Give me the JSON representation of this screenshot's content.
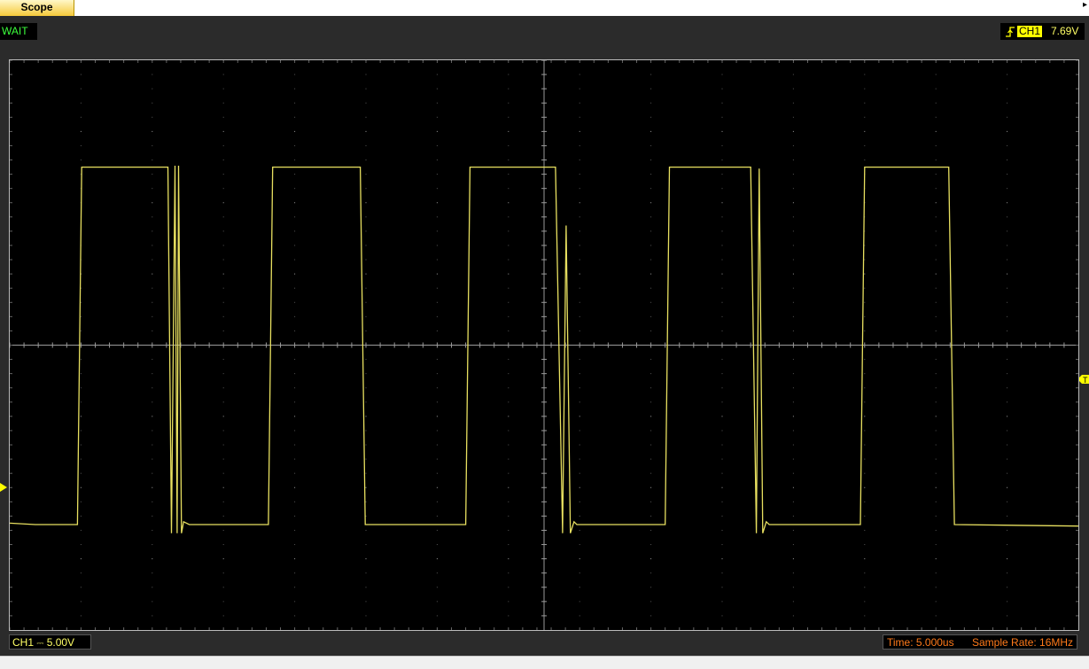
{
  "tab": {
    "label": "Scope"
  },
  "status": {
    "acquisition": "WAIT"
  },
  "trigger": {
    "channel": "CH1",
    "level": "7.69V",
    "edge": "rising-edge-icon"
  },
  "channel": {
    "name": "CH1",
    "coupling": "DC",
    "scale": "5.00V"
  },
  "timebase": {
    "time_label": "Time:",
    "time": "5.000us",
    "sample_label": "Sample Rate:",
    "sample_rate": "16MHz"
  },
  "colors": {
    "trace": "#e8e060",
    "grid": "#9a9a9a",
    "trigger_badge": "#ffff00",
    "info_text": "#ff7a1a",
    "status_ok": "#3cff3c"
  },
  "chart_data": {
    "type": "line",
    "title": "",
    "xlabel": "",
    "ylabel": "",
    "x_unit": "us",
    "y_unit": "V",
    "xlim": [
      0,
      75
    ],
    "ylim": [
      -10,
      10
    ],
    "grid": true,
    "divisions": {
      "x": 15,
      "y": 8
    },
    "series": [
      {
        "x": [
          0,
          1.8,
          4.75,
          5.05,
          11.1,
          11.35,
          11.6,
          11.75,
          11.85,
          12.05,
          12.2,
          12.6,
          18.15,
          18.45,
          24.6,
          24.95,
          32.0,
          32.3,
          38.3,
          38.8,
          39.05,
          39.35,
          39.6,
          39.8,
          46.0,
          46.3,
          52.0,
          52.4,
          52.6,
          52.85,
          53.1,
          53.3,
          59.7,
          60.0,
          65.9,
          66.3,
          75.0
        ],
        "y": [
          -6.25,
          -6.3,
          -6.3,
          6.25,
          6.25,
          -6.6,
          6.3,
          -6.6,
          6.3,
          -6.6,
          -6.2,
          -6.3,
          -6.3,
          6.25,
          6.25,
          -6.3,
          -6.3,
          6.25,
          6.25,
          -6.6,
          4.2,
          -6.6,
          -6.2,
          -6.3,
          -6.3,
          6.25,
          6.25,
          -6.6,
          6.2,
          -6.6,
          -6.2,
          -6.3,
          -6.3,
          6.25,
          6.25,
          -6.3,
          -6.35
        ]
      }
    ]
  }
}
